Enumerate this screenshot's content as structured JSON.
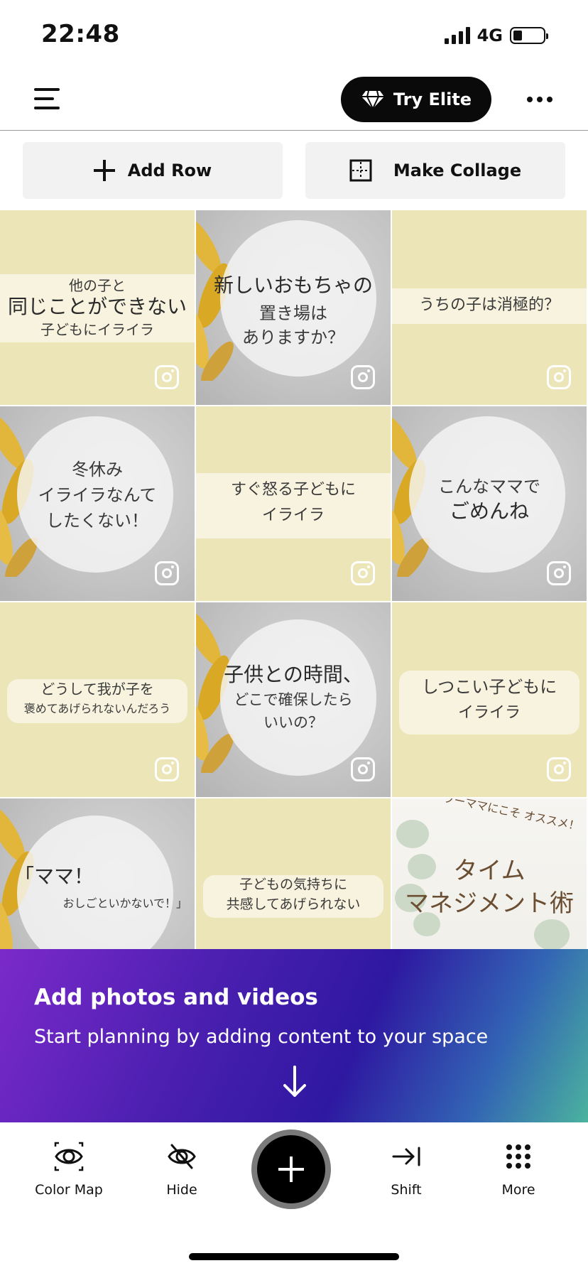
{
  "status": {
    "time": "22:48",
    "network": "4G"
  },
  "header": {
    "elite_label": "Try Elite"
  },
  "actions": {
    "add_row": "Add Row",
    "make_collage": "Make Collage"
  },
  "tiles": [
    {
      "lines": [
        "他の子と",
        "同じことができない",
        "子どもにイライラ"
      ]
    },
    {
      "lines": [
        "新しいおもちゃの",
        "置き場は",
        "ありますか？"
      ]
    },
    {
      "lines": [
        "うちの子は消極的？"
      ]
    },
    {
      "lines": [
        "冬休み",
        "イライラなんて",
        "したくない！"
      ]
    },
    {
      "lines": [
        "すぐ怒る子どもに",
        "イライラ"
      ]
    },
    {
      "lines": [
        "こんなママで",
        "ごめんね"
      ]
    },
    {
      "lines": [
        "どうして我が子を",
        "褒めてあげられないんだろう"
      ]
    },
    {
      "lines": [
        "子供との時間、",
        "どこで確保したら",
        "いいの？"
      ]
    },
    {
      "lines": [
        "しつこい子どもに",
        "イライラ"
      ]
    },
    {
      "lines": [
        "「ママ！",
        "おしごといかないで！」"
      ]
    },
    {
      "lines": [
        "子どもの気持ちに",
        "共感してあげられない"
      ]
    },
    {
      "lines": [
        "ワーママにこそ オススメ！",
        "タイム",
        "マネジメント術"
      ]
    }
  ],
  "banner": {
    "title": "Add photos and videos",
    "subtitle": "Start planning by adding content to your space"
  },
  "bottom_nav": {
    "color_map": "Color Map",
    "hide": "Hide",
    "shift": "Shift",
    "more": "More"
  }
}
